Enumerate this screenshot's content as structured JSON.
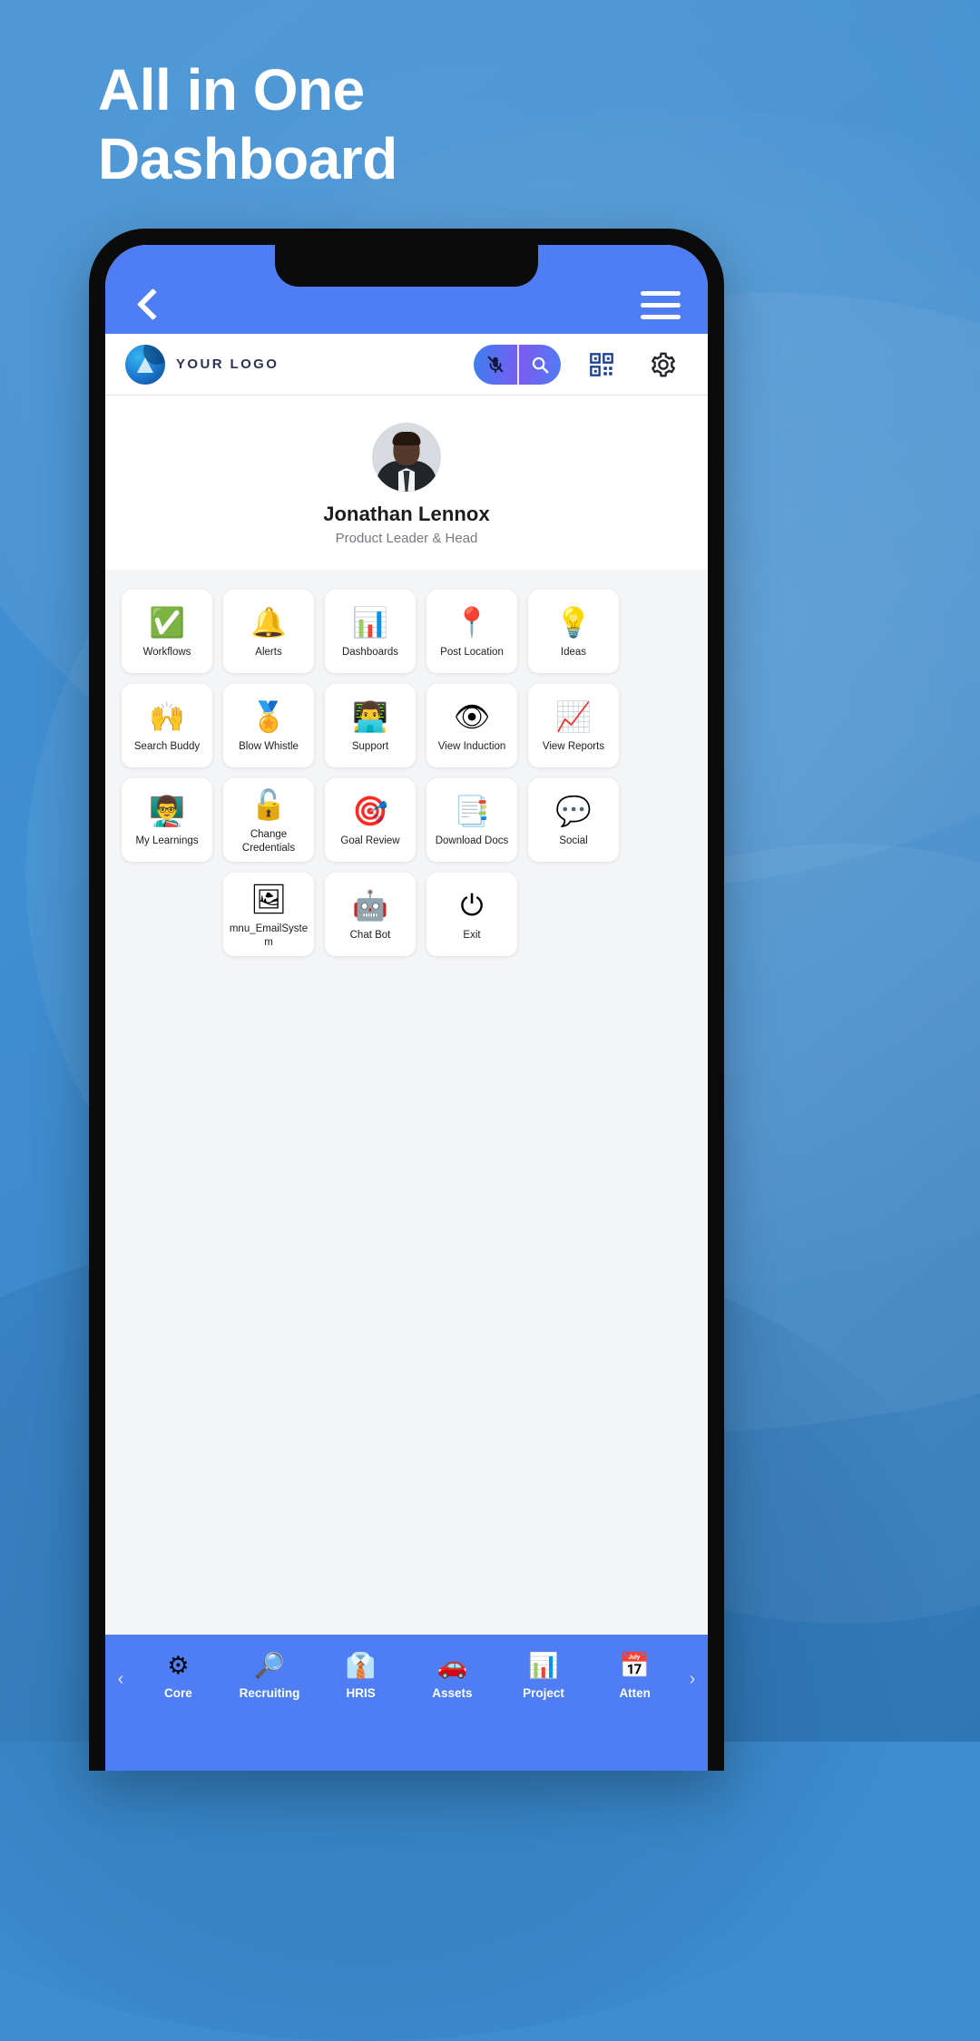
{
  "headline": "All in One\nDashboard",
  "colors": {
    "background": "#3d8dd0",
    "app_bar": "#4f7df3",
    "tile_surface": "#ffffff",
    "page_surface": "#f4f5f6",
    "accent_purple": "#7a5cf0"
  },
  "appbar": {
    "back_icon": "chevron-left-icon",
    "menu_icon": "hamburger-menu-icon"
  },
  "logobar": {
    "logo_text": "YOUR LOGO",
    "logo_icon": "brand-logo-icon",
    "mic_icon": "microphone-muted-icon",
    "search_icon": "search-icon",
    "qr_icon": "qr-code-icon",
    "gear_icon": "gear-icon"
  },
  "profile": {
    "name": "Jonathan Lennox",
    "role": "Product Leader & Head",
    "avatar_icon": "user-avatar"
  },
  "tiles": [
    [
      {
        "label": "Workflows",
        "icon": "check-circle-icon",
        "glyph": "✅"
      },
      {
        "label": "Alerts",
        "icon": "bell-icon",
        "glyph": "🔔"
      },
      {
        "label": "Dashboards",
        "icon": "pie-chart-icon",
        "glyph": "📊"
      },
      {
        "label": "Post Location",
        "icon": "map-pin-icon",
        "glyph": "📍"
      },
      {
        "label": "Ideas",
        "icon": "lightbulb-icon",
        "glyph": "💡"
      }
    ],
    [
      {
        "label": "Search Buddy",
        "icon": "people-handshake-icon",
        "glyph": "🙌"
      },
      {
        "label": "Blow Whistle",
        "icon": "whistle-icon",
        "glyph": "🏅"
      },
      {
        "label": "Support",
        "icon": "support-agent-icon",
        "glyph": "👨‍💻"
      },
      {
        "label": "View Induction",
        "icon": "document-eye-icon",
        "glyph": "👁"
      },
      {
        "label": "View Reports",
        "icon": "reports-chart-icon",
        "glyph": "📈"
      }
    ],
    [
      {
        "label": "My Learnings",
        "icon": "training-board-icon",
        "glyph": "👨‍🏫"
      },
      {
        "label": "Change Credentials",
        "icon": "unlock-icon",
        "glyph": "🔓"
      },
      {
        "label": "Goal Review",
        "icon": "target-icon",
        "glyph": "🎯"
      },
      {
        "label": "Download Docs",
        "icon": "download-document-icon",
        "glyph": "📑"
      },
      {
        "label": "Social",
        "icon": "social-chat-icon",
        "glyph": "💬"
      }
    ],
    [
      {
        "label": "mnu_EmailSystem",
        "icon": "broken-image-icon",
        "glyph": "🖼"
      },
      {
        "label": "Chat Bot",
        "icon": "robot-icon",
        "glyph": "🤖"
      },
      {
        "label": "Exit",
        "icon": "power-off-icon",
        "glyph": "⏻"
      }
    ]
  ],
  "bottomnav": {
    "prev_arrow": "‹",
    "next_arrow": "›",
    "items": [
      {
        "label": "Core",
        "icon": "gear-settings-icon",
        "glyph": "⚙"
      },
      {
        "label": "Recruiting",
        "icon": "recruit-search-icon",
        "glyph": "🔎"
      },
      {
        "label": "HRIS",
        "icon": "employee-icon",
        "glyph": "👔"
      },
      {
        "label": "Assets",
        "icon": "car-icon",
        "glyph": "🚗"
      },
      {
        "label": "Project",
        "icon": "bar-chart-icon",
        "glyph": "📊"
      },
      {
        "label": "Atten",
        "icon": "attendance-icon",
        "glyph": "📅"
      }
    ]
  }
}
